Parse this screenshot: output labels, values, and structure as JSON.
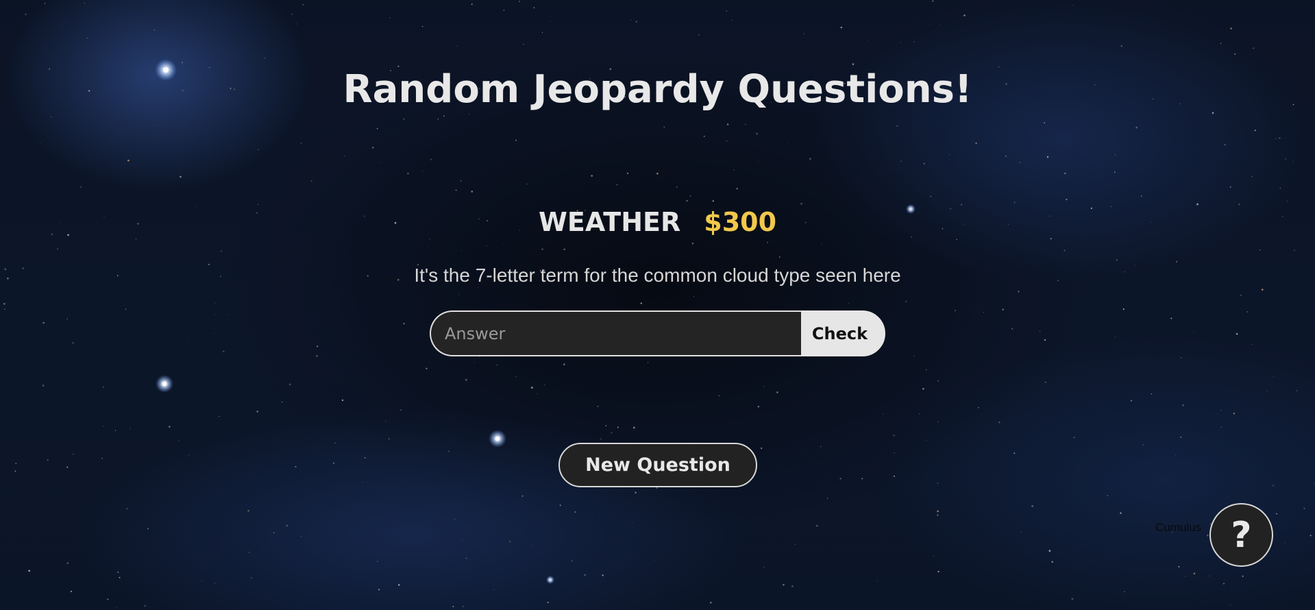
{
  "header": {
    "title": "Random Jeopardy Questions!"
  },
  "clue": {
    "category": "WEATHER",
    "value": "$300",
    "question": "It's the 7-letter term for the common cloud type seen here"
  },
  "answer_form": {
    "placeholder": "Answer",
    "value": "",
    "check_label": "Check"
  },
  "new_question_label": "New Question",
  "hint": {
    "text": "Cumulus",
    "help_label": "?"
  },
  "colors": {
    "value_accent": "#f2c84b",
    "text": "#e6e6e6",
    "button_dark": "#222222",
    "button_light": "#e6e6e6"
  },
  "icons": {
    "help": "question-mark-icon"
  }
}
